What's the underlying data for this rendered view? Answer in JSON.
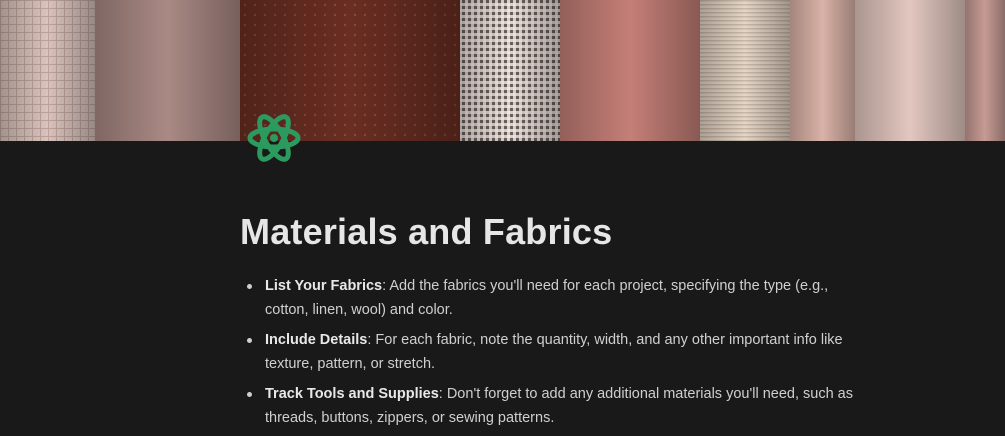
{
  "cover": {
    "image": "fabric-rolls-cover"
  },
  "page_icon": {
    "name": "atom-icon",
    "color": "#2c9a5e"
  },
  "page": {
    "title": "Materials and Fabrics",
    "bullets": [
      {
        "term": "List Your Fabrics",
        "text": ": Add the fabrics you'll need for each project, specifying the type (e.g., cotton, linen, wool) and color."
      },
      {
        "term": "Include Details",
        "text": ": For each fabric, note the quantity, width, and any other important info like texture, pattern, or stretch."
      },
      {
        "term": "Track Tools and Supplies",
        "text": ": Don't forget to add any additional materials you'll need, such as threads, buttons, zippers, or sewing patterns."
      }
    ]
  }
}
